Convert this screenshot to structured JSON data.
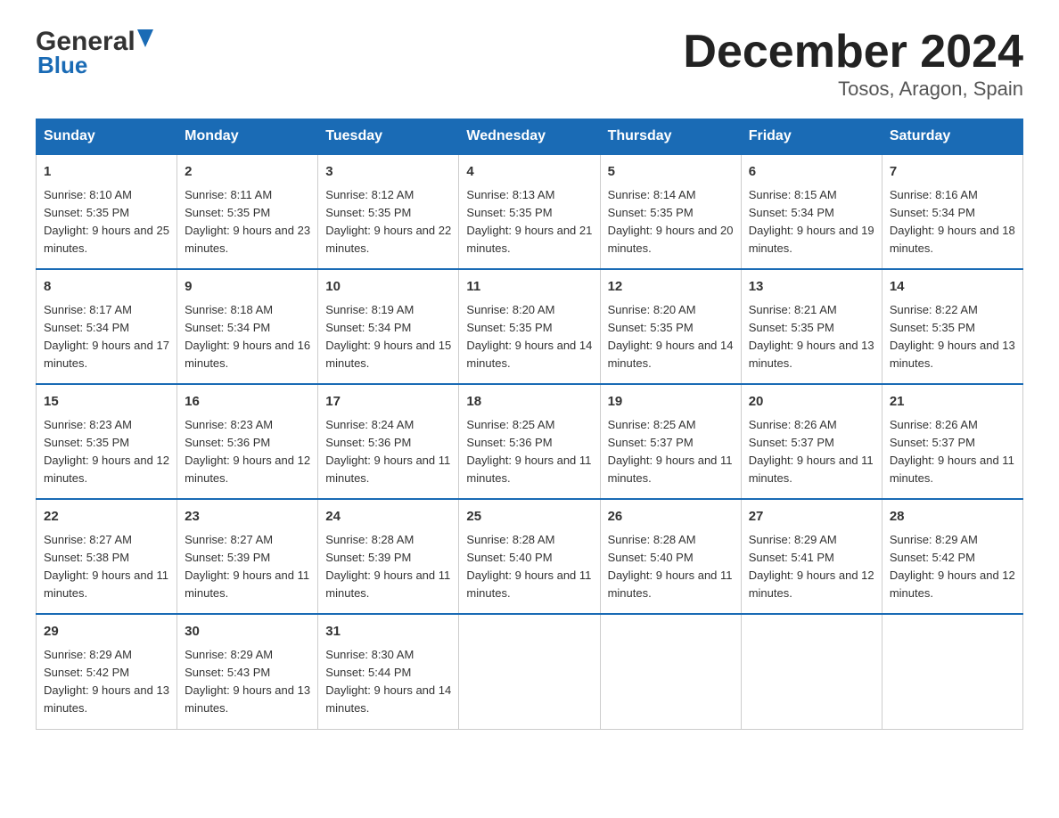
{
  "header": {
    "logo_general": "General",
    "logo_blue": "Blue",
    "title": "December 2024",
    "subtitle": "Tosos, Aragon, Spain"
  },
  "weekdays": [
    "Sunday",
    "Monday",
    "Tuesday",
    "Wednesday",
    "Thursday",
    "Friday",
    "Saturday"
  ],
  "weeks": [
    [
      {
        "day": "1",
        "sunrise": "8:10 AM",
        "sunset": "5:35 PM",
        "daylight": "9 hours and 25 minutes."
      },
      {
        "day": "2",
        "sunrise": "8:11 AM",
        "sunset": "5:35 PM",
        "daylight": "9 hours and 23 minutes."
      },
      {
        "day": "3",
        "sunrise": "8:12 AM",
        "sunset": "5:35 PM",
        "daylight": "9 hours and 22 minutes."
      },
      {
        "day": "4",
        "sunrise": "8:13 AM",
        "sunset": "5:35 PM",
        "daylight": "9 hours and 21 minutes."
      },
      {
        "day": "5",
        "sunrise": "8:14 AM",
        "sunset": "5:35 PM",
        "daylight": "9 hours and 20 minutes."
      },
      {
        "day": "6",
        "sunrise": "8:15 AM",
        "sunset": "5:34 PM",
        "daylight": "9 hours and 19 minutes."
      },
      {
        "day": "7",
        "sunrise": "8:16 AM",
        "sunset": "5:34 PM",
        "daylight": "9 hours and 18 minutes."
      }
    ],
    [
      {
        "day": "8",
        "sunrise": "8:17 AM",
        "sunset": "5:34 PM",
        "daylight": "9 hours and 17 minutes."
      },
      {
        "day": "9",
        "sunrise": "8:18 AM",
        "sunset": "5:34 PM",
        "daylight": "9 hours and 16 minutes."
      },
      {
        "day": "10",
        "sunrise": "8:19 AM",
        "sunset": "5:34 PM",
        "daylight": "9 hours and 15 minutes."
      },
      {
        "day": "11",
        "sunrise": "8:20 AM",
        "sunset": "5:35 PM",
        "daylight": "9 hours and 14 minutes."
      },
      {
        "day": "12",
        "sunrise": "8:20 AM",
        "sunset": "5:35 PM",
        "daylight": "9 hours and 14 minutes."
      },
      {
        "day": "13",
        "sunrise": "8:21 AM",
        "sunset": "5:35 PM",
        "daylight": "9 hours and 13 minutes."
      },
      {
        "day": "14",
        "sunrise": "8:22 AM",
        "sunset": "5:35 PM",
        "daylight": "9 hours and 13 minutes."
      }
    ],
    [
      {
        "day": "15",
        "sunrise": "8:23 AM",
        "sunset": "5:35 PM",
        "daylight": "9 hours and 12 minutes."
      },
      {
        "day": "16",
        "sunrise": "8:23 AM",
        "sunset": "5:36 PM",
        "daylight": "9 hours and 12 minutes."
      },
      {
        "day": "17",
        "sunrise": "8:24 AM",
        "sunset": "5:36 PM",
        "daylight": "9 hours and 11 minutes."
      },
      {
        "day": "18",
        "sunrise": "8:25 AM",
        "sunset": "5:36 PM",
        "daylight": "9 hours and 11 minutes."
      },
      {
        "day": "19",
        "sunrise": "8:25 AM",
        "sunset": "5:37 PM",
        "daylight": "9 hours and 11 minutes."
      },
      {
        "day": "20",
        "sunrise": "8:26 AM",
        "sunset": "5:37 PM",
        "daylight": "9 hours and 11 minutes."
      },
      {
        "day": "21",
        "sunrise": "8:26 AM",
        "sunset": "5:37 PM",
        "daylight": "9 hours and 11 minutes."
      }
    ],
    [
      {
        "day": "22",
        "sunrise": "8:27 AM",
        "sunset": "5:38 PM",
        "daylight": "9 hours and 11 minutes."
      },
      {
        "day": "23",
        "sunrise": "8:27 AM",
        "sunset": "5:39 PM",
        "daylight": "9 hours and 11 minutes."
      },
      {
        "day": "24",
        "sunrise": "8:28 AM",
        "sunset": "5:39 PM",
        "daylight": "9 hours and 11 minutes."
      },
      {
        "day": "25",
        "sunrise": "8:28 AM",
        "sunset": "5:40 PM",
        "daylight": "9 hours and 11 minutes."
      },
      {
        "day": "26",
        "sunrise": "8:28 AM",
        "sunset": "5:40 PM",
        "daylight": "9 hours and 11 minutes."
      },
      {
        "day": "27",
        "sunrise": "8:29 AM",
        "sunset": "5:41 PM",
        "daylight": "9 hours and 12 minutes."
      },
      {
        "day": "28",
        "sunrise": "8:29 AM",
        "sunset": "5:42 PM",
        "daylight": "9 hours and 12 minutes."
      }
    ],
    [
      {
        "day": "29",
        "sunrise": "8:29 AM",
        "sunset": "5:42 PM",
        "daylight": "9 hours and 13 minutes."
      },
      {
        "day": "30",
        "sunrise": "8:29 AM",
        "sunset": "5:43 PM",
        "daylight": "9 hours and 13 minutes."
      },
      {
        "day": "31",
        "sunrise": "8:30 AM",
        "sunset": "5:44 PM",
        "daylight": "9 hours and 14 minutes."
      },
      null,
      null,
      null,
      null
    ]
  ]
}
